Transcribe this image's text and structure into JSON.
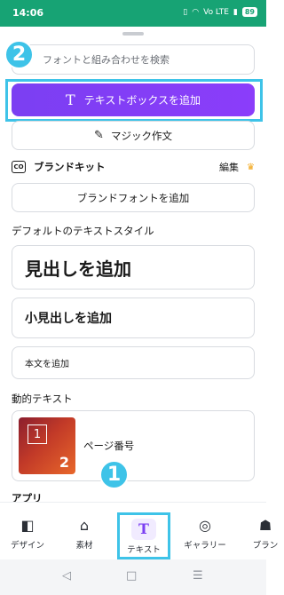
{
  "statusbar": {
    "time": "14:06",
    "network_label": "Vo LTE",
    "battery": "89"
  },
  "search": {
    "placeholder": "フォントと組み合わせを検索",
    "icon": "search-icon"
  },
  "add_textbox": {
    "icon": "T",
    "label": "テキストボックスを追加"
  },
  "callouts": {
    "step_1": "1",
    "step_2": "2"
  },
  "magic": {
    "icon": "magic-wand-icon",
    "label": "マジック作文"
  },
  "brandkit": {
    "icon_text": "CO",
    "label": "ブランドキット",
    "edit_label": "編集",
    "crown": "♛"
  },
  "brandfont": {
    "label": "ブランドフォントを追加"
  },
  "default_styles": {
    "section_title": "デフォルトのテキストスタイル",
    "heading": "見出しを追加",
    "subheading": "小見出しを追加",
    "body": "本文を追加"
  },
  "dynamic": {
    "section_title": "動的テキスト",
    "page_number": {
      "label": "ページ番号",
      "thumb_1": "1",
      "thumb_2": "2"
    }
  },
  "apps": {
    "section_title": "アプリ"
  },
  "tabbar": {
    "tabs": [
      {
        "label": "デザイン",
        "icon": "layout-icon",
        "glyph": "◧"
      },
      {
        "label": "素材",
        "icon": "shapes-icon",
        "glyph": "⌂"
      },
      {
        "label": "テキスト",
        "icon": "text-icon",
        "glyph": "T",
        "active": true
      },
      {
        "label": "ギャラリー",
        "icon": "camera-icon",
        "glyph": "◎"
      },
      {
        "label": "ブラン",
        "icon": "brand-icon",
        "glyph": "☗"
      }
    ]
  },
  "navbar": {
    "back": "◁",
    "home": "□",
    "menu": "☰"
  },
  "colors": {
    "accent": "#7b3ff2",
    "callout": "#3ec3e8",
    "statusbar": "#17a374"
  }
}
